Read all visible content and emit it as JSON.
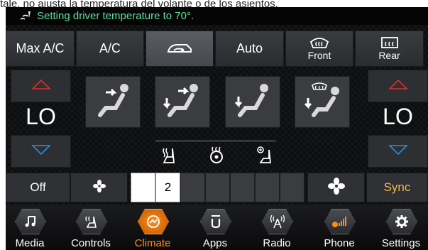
{
  "caption": "tale, no ajusta la temperatura del volante o de los asientos.",
  "status": {
    "voice_icon": "voice-command-icon",
    "message": "Setting driver temperature to 70°."
  },
  "top_buttons": [
    {
      "label": "Max A/C"
    },
    {
      "label": "A/C"
    },
    {
      "label": "",
      "icon": "recirculation-icon"
    },
    {
      "label": "Auto"
    },
    {
      "label": "Front",
      "icon": "front-defrost-icon"
    },
    {
      "label": "Rear",
      "icon": "rear-defrost-icon"
    }
  ],
  "driver_temp": "LO",
  "passenger_temp": "LO",
  "fan": {
    "off_label": "Off",
    "level_value": "2",
    "level": 2,
    "max_level": 9,
    "sync_label": "Sync"
  },
  "nav": [
    {
      "label": "Media",
      "icon": "music-note-icon"
    },
    {
      "label": "Controls",
      "icon": "controls-icon"
    },
    {
      "label": "Climate",
      "icon": "climate-icon",
      "active": true
    },
    {
      "label": "Apps",
      "icon": "apps-icon"
    },
    {
      "label": "Radio",
      "icon": "radio-tower-icon"
    },
    {
      "label": "Phone",
      "icon": "phone-icon"
    },
    {
      "label": "Settings",
      "icon": "gear-icon"
    }
  ],
  "colors": {
    "accent": "#ff8a1a",
    "status_text": "#5ee09a",
    "sync": "#f2b84b",
    "arrow_up": "#d63030",
    "arrow_down": "#2a8fd6"
  }
}
